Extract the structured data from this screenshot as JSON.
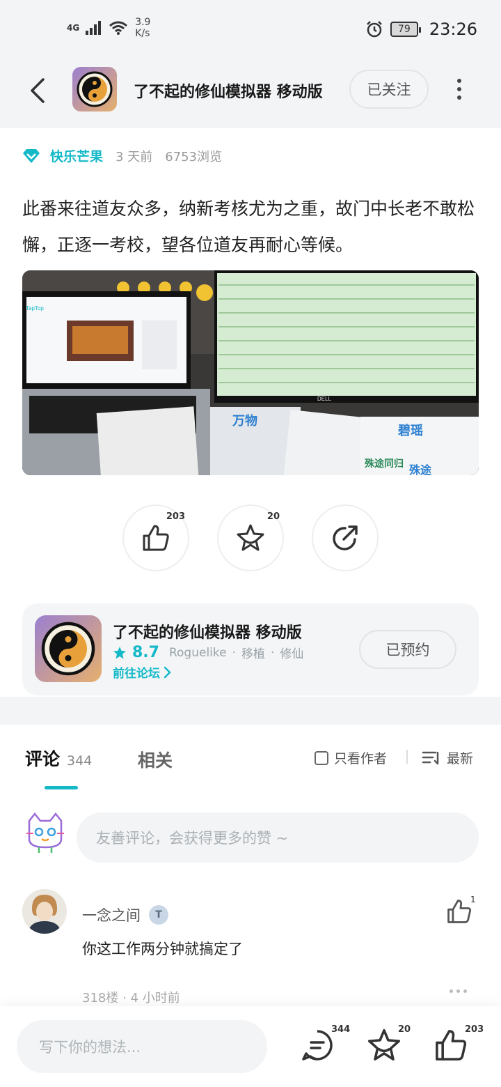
{
  "status_bar": {
    "network": "4G",
    "speed": "3.9",
    "speed_unit": "K/s",
    "battery": "79",
    "time": "23:26"
  },
  "header": {
    "title": "了不起的修仙模拟器 移动版",
    "follow_label": "已关注"
  },
  "post": {
    "author": "快乐芒果",
    "time_ago": "3 天前",
    "views": "6753浏览",
    "text": "此番来往道友众多，纳新考核尤为之重，故门中长老不敢松懈，正逐一考校，望各位道友再耐心等候。",
    "image_texts": {
      "left_brand": "TapTop",
      "monitor_brand": "DELL",
      "paper_1": "万物",
      "paper_2": "碧瑶",
      "paper_3": "殊途同归",
      "paper_4": "殊途"
    }
  },
  "actions": {
    "like_count": "203",
    "favorite_count": "20"
  },
  "app_card": {
    "title": "了不起的修仙模拟器 移动版",
    "rating": "8.7",
    "tags": [
      "Roguelike",
      "移植",
      "修仙"
    ],
    "link": "前往论坛",
    "reserved_label": "已预约"
  },
  "comments_section": {
    "tab_comments": "评论",
    "comment_count": "344",
    "tab_related": "相关",
    "filter_author": "只看作者",
    "sort_label": "最新",
    "input_placeholder": "友善评论，会获得更多的赞 ~"
  },
  "comment": {
    "name": "一念之间",
    "badge": "T",
    "text": "你这工作两分钟就搞定了",
    "likes": "1",
    "meta": "318楼 · 4 小时前"
  },
  "bottom_bar": {
    "placeholder": "写下你的想法...",
    "comment_count": "344",
    "favorite_count": "20",
    "like_count": "203"
  },
  "colors": {
    "accent": "#14b9c8",
    "background": "#f2f4f6"
  }
}
